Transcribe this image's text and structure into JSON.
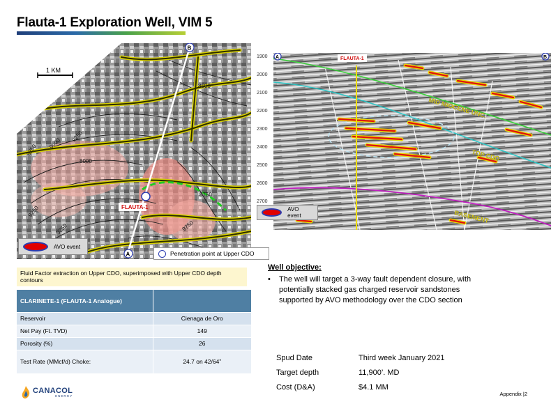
{
  "page": {
    "title": "Flauta-1 Exploration Well, VIM 5",
    "footer": "Appendix |2"
  },
  "map": {
    "scale_label": "1 KM",
    "well_label": "FLAUTA-1",
    "point_a": "A",
    "point_b": "B",
    "contours": [
      "8000",
      "8250",
      "8500",
      "9000",
      "9250",
      "9500",
      "8750",
      "9750",
      "9250",
      "9250"
    ],
    "avo_legend_label": "AVO event",
    "penetration_legend_label": "Penetration point at Upper CDO",
    "caption": "Fluid Factor extraction on Upper CDO, superimposed with Upper CDO depth contours"
  },
  "seismic": {
    "well_label": "FLAUTA-1",
    "point_a": "A",
    "point_b": "B",
    "depth_ticks": [
      "1900",
      "2000",
      "2100",
      "2200",
      "2300",
      "2400",
      "2500",
      "2600",
      "2700"
    ],
    "horizon_labels": [
      "MID MIOCENE UNC.",
      "TOP CDO",
      "BASEMENT"
    ],
    "avo_legend_label": "AVO event",
    "colors": {
      "mid_miocene": "#3ad03a",
      "top_cdo": "#2fc4c4",
      "basement": "#c020c0",
      "well": "#f0e000"
    }
  },
  "table": {
    "header": "CLARINETE-1 (FLAUTA-1 Analogue)",
    "header_color": "#4f7fa3",
    "rows": [
      {
        "label": "Reservoir",
        "value": "Cienaga de Oro"
      },
      {
        "label": "Net Pay  (Ft. TVD)",
        "value": "149"
      },
      {
        "label": "Porosity (%)",
        "value": "26"
      },
      {
        "label": "Test Rate (MMcf/d)  Choke:",
        "value": "24.7 on 42/64”"
      }
    ]
  },
  "objective": {
    "heading": "Well objective:",
    "bullet": "•",
    "text": "The well will target a 3-way fault dependent closure, with potentially stacked gas charged reservoir sandstones supported by AVO methodology over the CDO section"
  },
  "facts": [
    {
      "label": "Spud Date",
      "value": "Third week January 2021"
    },
    {
      "label": "Target depth",
      "value": "11,900’. MD"
    },
    {
      "label": "Cost (D&A)",
      "value": "$4.1 MM"
    }
  ],
  "logo": {
    "name": "CANACOL",
    "sub": "ENERGY"
  }
}
